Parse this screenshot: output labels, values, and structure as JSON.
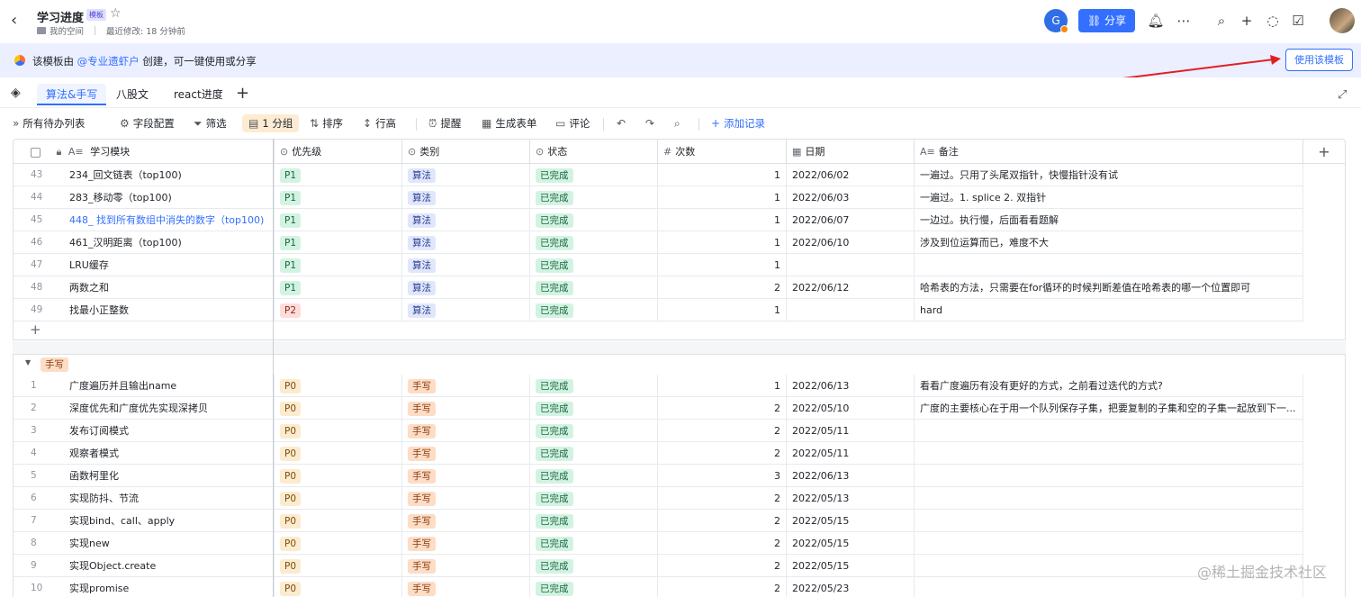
{
  "header": {
    "back_icon": "chevron-left-icon",
    "title": "学习进度",
    "template_badge": "模板",
    "location": "我的空间",
    "last_modified": "最近修改: 18 分钟前",
    "avatar_letter": "G",
    "share_label": "分享"
  },
  "banner": {
    "text_prefix": "该模板由 ",
    "author": "@专业遗虾户",
    "text_suffix": " 创建，可一键使用或分享",
    "use_button": "使用该模板"
  },
  "tabs": [
    {
      "label": "算法&手写",
      "active": true
    },
    {
      "label": "八股文",
      "active": false
    },
    {
      "label": "react进度",
      "active": false
    }
  ],
  "toolbar": {
    "view_name": "所有待办列表",
    "field_config": "字段配置",
    "filter": "筛选",
    "group": "1 分组",
    "sort": "排序",
    "row_height": "行高",
    "remind": "提醒",
    "gen_form": "生成表单",
    "comment": "评论",
    "add_record": "添加记录"
  },
  "columns": [
    {
      "label": "学习模块",
      "icon": "text-field-icon"
    },
    {
      "label": "优先级",
      "icon": "single-select-icon"
    },
    {
      "label": "类别",
      "icon": "single-select-icon"
    },
    {
      "label": "状态",
      "icon": "single-select-icon"
    },
    {
      "label": "次数",
      "icon": "number-icon"
    },
    {
      "label": "日期",
      "icon": "calendar-icon"
    },
    {
      "label": "备注",
      "icon": "text-field-icon"
    }
  ],
  "group1_rows": [
    {
      "n": "43",
      "name": "234_回文链表（top100)",
      "link": false,
      "prio": "P1",
      "cat": "算法",
      "status": "已完成",
      "count": "1",
      "date": "2022/06/02",
      "note": "一遍过。只用了头尾双指针，快慢指针没有试"
    },
    {
      "n": "44",
      "name": "283_移动零（top100)",
      "link": false,
      "prio": "P1",
      "cat": "算法",
      "status": "已完成",
      "count": "1",
      "date": "2022/06/03",
      "note": "一遍过。1. splice 2. 双指针"
    },
    {
      "n": "45",
      "name": "448_ 找到所有数组中消失的数字（top100)",
      "link": true,
      "prio": "P1",
      "cat": "算法",
      "status": "已完成",
      "count": "1",
      "date": "2022/06/07",
      "note": "一边过。执行慢，后面看看题解"
    },
    {
      "n": "46",
      "name": "461_汉明距离（top100)",
      "link": false,
      "prio": "P1",
      "cat": "算法",
      "status": "已完成",
      "count": "1",
      "date": "2022/06/10",
      "note": "涉及到位运算而已，难度不大"
    },
    {
      "n": "47",
      "name": "LRU缓存",
      "link": false,
      "prio": "P1",
      "cat": "算法",
      "status": "已完成",
      "count": "1",
      "date": "",
      "note": ""
    },
    {
      "n": "48",
      "name": "两数之和",
      "link": false,
      "prio": "P1",
      "cat": "算法",
      "status": "已完成",
      "count": "2",
      "date": "2022/06/12",
      "note": "哈希表的方法，只需要在for循环的时候判断差值在哈希表的哪一个位置即可"
    },
    {
      "n": "49",
      "name": "找最小正整数",
      "link": false,
      "prio": "P2",
      "cat": "算法",
      "status": "已完成",
      "count": "1",
      "date": "",
      "note": "hard"
    }
  ],
  "group2": {
    "label": "手写",
    "rows": [
      {
        "n": "1",
        "name": "广度遍历并且输出name",
        "prio": "P0",
        "cat": "手写",
        "status": "已完成",
        "count": "1",
        "date": "2022/06/13",
        "note": "看看广度遍历有没有更好的方式，之前看过迭代的方式?"
      },
      {
        "n": "2",
        "name": "深度优先和广度优先实现深拷贝",
        "prio": "P0",
        "cat": "手写",
        "status": "已完成",
        "count": "2",
        "date": "2022/05/10",
        "note": "广度的主要核心在于用一个队列保存子集，把要复制的子集和空的子集一起放到下一..."
      },
      {
        "n": "3",
        "name": "发布订阅模式",
        "prio": "P0",
        "cat": "手写",
        "status": "已完成",
        "count": "2",
        "date": "2022/05/11",
        "note": ""
      },
      {
        "n": "4",
        "name": "观察者模式",
        "prio": "P0",
        "cat": "手写",
        "status": "已完成",
        "count": "2",
        "date": "2022/05/11",
        "note": ""
      },
      {
        "n": "5",
        "name": "函数柯里化",
        "prio": "P0",
        "cat": "手写",
        "status": "已完成",
        "count": "3",
        "date": "2022/06/13",
        "note": ""
      },
      {
        "n": "6",
        "name": "实现防抖、节流",
        "prio": "P0",
        "cat": "手写",
        "status": "已完成",
        "count": "2",
        "date": "2022/05/13",
        "note": ""
      },
      {
        "n": "7",
        "name": "实现bind、call、apply",
        "prio": "P0",
        "cat": "手写",
        "status": "已完成",
        "count": "2",
        "date": "2022/05/15",
        "note": ""
      },
      {
        "n": "8",
        "name": "实现new",
        "prio": "P0",
        "cat": "手写",
        "status": "已完成",
        "count": "2",
        "date": "2022/05/15",
        "note": ""
      },
      {
        "n": "9",
        "name": "实现Object.create",
        "prio": "P0",
        "cat": "手写",
        "status": "已完成",
        "count": "2",
        "date": "2022/05/15",
        "note": ""
      },
      {
        "n": "10",
        "name": "实现promise",
        "prio": "P0",
        "cat": "手写",
        "status": "已完成",
        "count": "2",
        "date": "2022/05/23",
        "note": ""
      }
    ]
  },
  "watermark": "@稀土掘金技术社区"
}
